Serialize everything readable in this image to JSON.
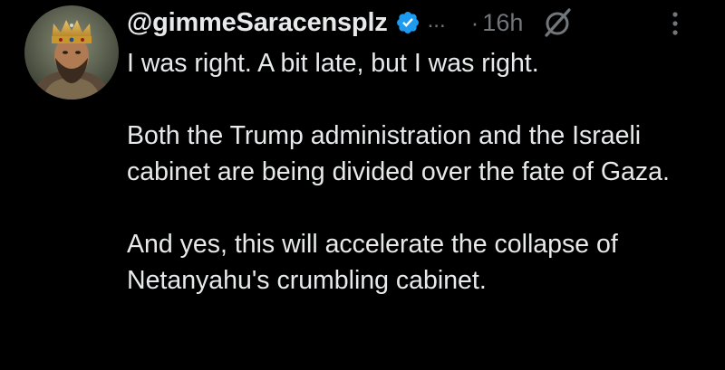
{
  "tweet": {
    "handle": "@gimmeSaracensplz",
    "ellipsis": "...",
    "dot": "·",
    "time": "16h",
    "paragraphs": [
      "I was right. A bit late, but I was right.",
      "Both the Trump administration and the Israeli cabinet are being divided over the fate of Gaza.",
      "And yes, this will accelerate the collapse of Netanyahu's crumbling cabinet."
    ]
  },
  "icons": {
    "verified": "verified-badge-icon",
    "grok": "grok-icon",
    "more": "more-vertical-icon"
  },
  "colors": {
    "background": "#000000",
    "text": "#e7e9ea",
    "muted": "#71767b",
    "verified": "#1d9bf0"
  }
}
